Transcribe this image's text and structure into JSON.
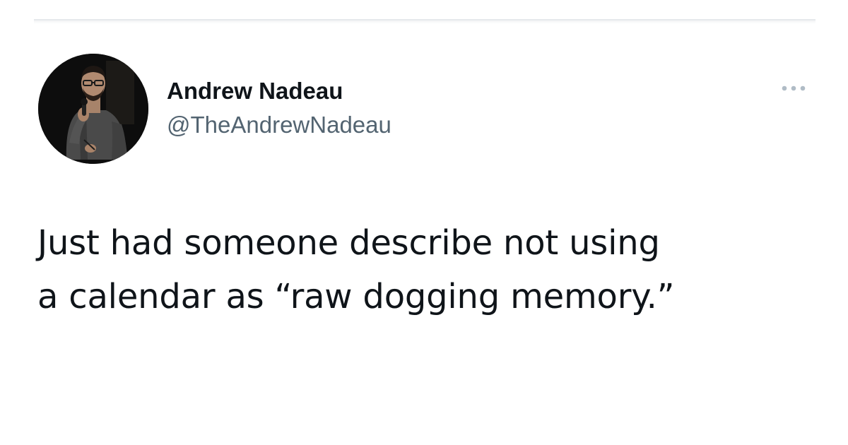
{
  "tweet": {
    "author": {
      "display_name": "Andrew Nadeau",
      "handle": "@TheAndrewNadeau",
      "avatar_icon": "profile-photo"
    },
    "more_icon": "more-horizontal-icon",
    "text_lines": [
      "Just had someone describe not using",
      "a calendar as “raw dogging memory.”"
    ]
  },
  "colors": {
    "background": "#ffffff",
    "primary_text": "#0f1419",
    "secondary_text": "#536471",
    "divider": "#e6e9ec",
    "more_icon": "#b0bcc6"
  }
}
